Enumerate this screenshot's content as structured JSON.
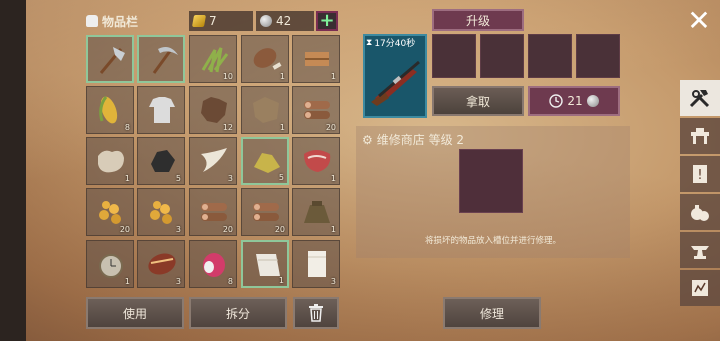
{
  "inventory": {
    "title": "物品栏",
    "gold": "7",
    "silver": "42",
    "add_label": "+",
    "slots": [
      {
        "icon": "axe-icon",
        "count": ""
      },
      {
        "icon": "pickaxe-icon",
        "count": ""
      },
      {
        "icon": "herbs-icon",
        "count": "10"
      },
      {
        "icon": "meat-leg-icon",
        "count": "1"
      },
      {
        "icon": "cloth-bundle-icon",
        "count": "1"
      },
      {
        "icon": "corn-icon",
        "count": "8"
      },
      {
        "icon": "shirt-icon",
        "count": ""
      },
      {
        "icon": "leather-icon",
        "count": "12"
      },
      {
        "icon": "hide-icon",
        "count": "1"
      },
      {
        "icon": "logs-icon",
        "count": "20"
      },
      {
        "icon": "fur-icon",
        "count": "1"
      },
      {
        "icon": "coal-icon",
        "count": "5"
      },
      {
        "icon": "fang-icon",
        "count": "3"
      },
      {
        "icon": "sulfur-icon",
        "count": "5"
      },
      {
        "icon": "steak-icon",
        "count": "1"
      },
      {
        "icon": "gold-nuggets-icon",
        "count": "20"
      },
      {
        "icon": "gold-nuggets-icon",
        "count": "3"
      },
      {
        "icon": "logs-icon",
        "count": "20"
      },
      {
        "icon": "logs-icon",
        "count": "20"
      },
      {
        "icon": "sack-icon",
        "count": "1"
      },
      {
        "icon": "pocket-watch-icon",
        "count": "1"
      },
      {
        "icon": "roasted-meat-icon",
        "count": "3"
      },
      {
        "icon": "dragon-fruit-icon",
        "count": "8"
      },
      {
        "icon": "bandage-icon",
        "count": "1"
      },
      {
        "icon": "paper-roll-icon",
        "count": "3"
      }
    ]
  },
  "buttons": {
    "use": "使用",
    "split": "拆分",
    "repair": "修理",
    "pickup": "拿取"
  },
  "upgrade": {
    "tab_label": "升级",
    "timer": "17分40秒",
    "speed_cost": "21"
  },
  "shop": {
    "title": "维修商店 等级 2",
    "hint": "将损坏的物品放入槽位并进行修理。"
  },
  "close_label": "✕",
  "colors": {
    "accent": "#6e3a4f",
    "selected_border": "#8fc79a",
    "rifle_bg": "#19566a"
  }
}
